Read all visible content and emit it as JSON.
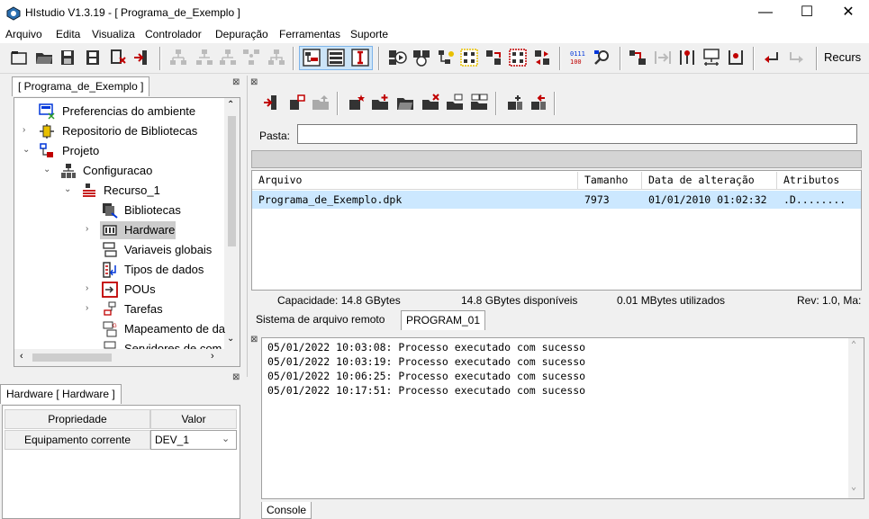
{
  "window": {
    "title": "HIstudio V1.3.19 - [ Programa_de_Exemplo ]",
    "minimize": "—",
    "maximize": "☐",
    "close": "✕"
  },
  "menu": [
    "Arquivo",
    "Edita",
    "Visualiza",
    "Controlador",
    "Depuração",
    "Ferramentas",
    "Suporte"
  ],
  "toolbar": {
    "recurs_label": "Recurs"
  },
  "left_panel": {
    "tab": "[ Programa_de_Exemplo ]",
    "tree": [
      "Preferencias do ambiente",
      "Repositorio de Bibliotecas",
      "Projeto",
      "Configuracao",
      "Recurso_1",
      "Bibliotecas",
      "Hardware",
      "Variaveis globais",
      "Tipos de dados",
      "POUs",
      "Tarefas",
      "Mapeamento de da",
      "Servidores de com"
    ]
  },
  "property_panel": {
    "tab": "Hardware [ Hardware ]",
    "col_property": "Propriedade",
    "col_value": "Valor",
    "row_property": "Equipamento corrente",
    "row_value": "DEV_1"
  },
  "file_panel": {
    "pasta_label": "Pasta:",
    "pasta_value": "",
    "columns": [
      "Arquivo",
      "Tamanho",
      "Data de alteração",
      "Atributos"
    ],
    "rows": [
      {
        "name": "Programa_de_Exemplo.dpk",
        "size": "7973",
        "date": "01/01/2010 01:02:32",
        "attrs": ".D........"
      }
    ],
    "status": {
      "capacity": "Capacidade: 14.8 GBytes",
      "available": "14.8 GBytes disponíveis",
      "used": "0.01 MBytes utilizados",
      "rev": "Rev: 1.0, Ma:"
    }
  },
  "bottom_tabs": [
    "Sistema de arquivo remoto",
    "PROGRAM_01"
  ],
  "console": {
    "lines": [
      "05/01/2022 10:03:08: Processo executado com sucesso",
      "05/01/2022 10:03:19: Processo executado com sucesso",
      "05/01/2022 10:06:25: Processo executado com sucesso",
      "05/01/2022 10:17:51: Processo executado com sucesso"
    ],
    "tab": "Console"
  },
  "colors": {
    "selection": "#cce8ff",
    "accent": "#0078d7",
    "red": "#c00000",
    "blue": "#0037da",
    "yellow": "#e8c000"
  }
}
